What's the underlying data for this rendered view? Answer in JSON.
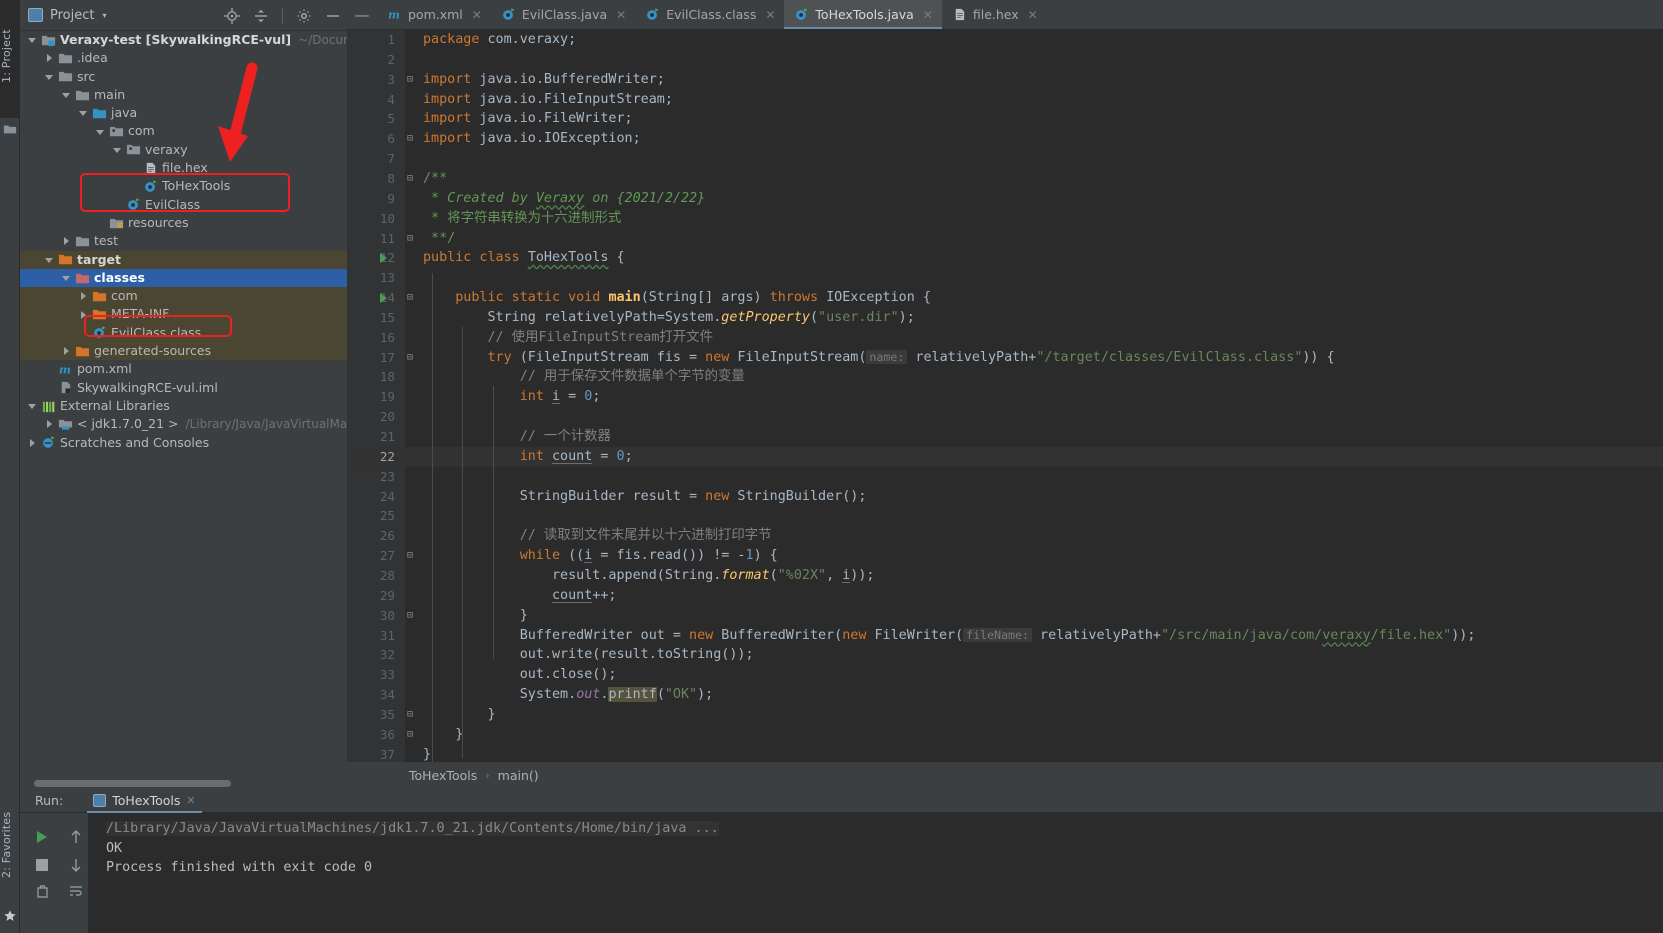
{
  "window": {
    "left_stripe": [
      {
        "label": "1: Project",
        "icon": "project-icon",
        "selected": true
      },
      {
        "label": "2: Favorites",
        "icon": "star-icon",
        "selected": false
      }
    ]
  },
  "project_panel": {
    "title": "Project",
    "caret": "▾",
    "icons": [
      "locate-icon",
      "collapse-all-icon",
      "gear-icon",
      "minimize-icon"
    ],
    "tree": [
      {
        "depth": 0,
        "arrow": "down",
        "icon": "module-icon",
        "label": "Veraxy-test [SkywalkingRCE-vul]",
        "bold": true,
        "sub": "~/Documents/"
      },
      {
        "depth": 1,
        "arrow": "right",
        "icon": "folder-icon",
        "label": ".idea"
      },
      {
        "depth": 1,
        "arrow": "down",
        "icon": "folder-icon",
        "label": "src"
      },
      {
        "depth": 2,
        "arrow": "down",
        "icon": "folder-icon",
        "label": "main"
      },
      {
        "depth": 3,
        "arrow": "down",
        "icon": "source-folder-icon",
        "label": "java"
      },
      {
        "depth": 4,
        "arrow": "down",
        "icon": "package-icon",
        "label": "com"
      },
      {
        "depth": 5,
        "arrow": "down",
        "icon": "package-icon",
        "label": "veraxy"
      },
      {
        "depth": 6,
        "arrow": "none",
        "icon": "file-icon",
        "label": "file.hex"
      },
      {
        "depth": 6,
        "arrow": "none",
        "icon": "java-class-icon",
        "label": "ToHexTools"
      },
      {
        "depth": 5,
        "arrow": "none",
        "icon": "java-class-icon",
        "label": "EvilClass"
      },
      {
        "depth": 4,
        "arrow": "none",
        "icon": "resources-folder-icon",
        "label": "resources"
      },
      {
        "depth": 2,
        "arrow": "right",
        "icon": "folder-icon",
        "label": "test"
      },
      {
        "depth": 1,
        "arrow": "down",
        "icon": "target-folder-icon",
        "label": "target",
        "bold": true,
        "context": true
      },
      {
        "depth": 2,
        "arrow": "down",
        "icon": "excluded-folder-icon",
        "label": "classes",
        "bold": true,
        "selected": true
      },
      {
        "depth": 3,
        "arrow": "right",
        "icon": "target-folder-icon",
        "label": "com",
        "context": true
      },
      {
        "depth": 3,
        "arrow": "right",
        "icon": "target-folder-icon",
        "label": "META-INF",
        "context": true
      },
      {
        "depth": 3,
        "arrow": "none",
        "icon": "java-class-icon",
        "label": "EvilClass.class",
        "context": true
      },
      {
        "depth": 2,
        "arrow": "right",
        "icon": "target-folder-icon",
        "label": "generated-sources",
        "context": true
      },
      {
        "depth": 1,
        "arrow": "none",
        "icon": "maven-icon",
        "label": "pom.xml"
      },
      {
        "depth": 1,
        "arrow": "none",
        "icon": "iml-icon",
        "label": "SkywalkingRCE-vul.iml"
      },
      {
        "depth": 0,
        "arrow": "down",
        "icon": "libraries-icon",
        "label": "External Libraries"
      },
      {
        "depth": 1,
        "arrow": "right",
        "icon": "jdk-icon",
        "label": "< jdk1.7.0_21 >",
        "sub": "/Library/Java/JavaVirtualMachin"
      },
      {
        "depth": 0,
        "arrow": "right",
        "icon": "scratches-icon",
        "label": "Scratches and Consoles"
      }
    ],
    "highlight_color": "#ef2020"
  },
  "tabs": {
    "minimize_glyph": "—",
    "items": [
      {
        "label": "pom.xml",
        "icon": "maven-icon",
        "active": false
      },
      {
        "label": "EvilClass.java",
        "icon": "java-class-icon",
        "active": false
      },
      {
        "label": "EvilClass.class",
        "icon": "java-class-icon",
        "active": false
      },
      {
        "label": "ToHexTools.java",
        "icon": "java-class-icon",
        "active": true
      },
      {
        "label": "file.hex",
        "icon": "file-icon",
        "active": false
      }
    ],
    "close_glyph": "✕"
  },
  "editor": {
    "current_line": 22,
    "lines": [
      {
        "n": 1,
        "html": "<span class=\"k\">package</span> com.veraxy;"
      },
      {
        "n": 2,
        "html": ""
      },
      {
        "n": 3,
        "fold": "⊟",
        "html": "<span class=\"k\">import</span> java.io.BufferedWriter;"
      },
      {
        "n": 4,
        "html": "<span class=\"k\">import</span> java.io.FileInputStream;"
      },
      {
        "n": 5,
        "html": "<span class=\"k\">import</span> java.io.FileWriter;"
      },
      {
        "n": 6,
        "fold": "⊟",
        "html": "<span class=\"k\">import</span> java.io.IOException;"
      },
      {
        "n": 7,
        "html": ""
      },
      {
        "n": 8,
        "fold": "⊟",
        "html": "<span class=\"jd\">/**</span>"
      },
      {
        "n": 9,
        "html": "<span class=\"jdi\"> * Created by </span><span class=\"jdi sq\">Veraxy</span><span class=\"jdi\"> on {2021/2/22}</span>"
      },
      {
        "n": 10,
        "html": "<span class=\"jd\"> * 将字符串转换为十六进制形式</span>"
      },
      {
        "n": 11,
        "fold": "⊟",
        "html": "<span class=\"jd\"> **/</span>"
      },
      {
        "n": 12,
        "run": true,
        "html": "<span class=\"k\">public class</span> <span class=\"sq\">ToHexTools</span> {"
      },
      {
        "n": 13,
        "html": ""
      },
      {
        "n": 14,
        "run": true,
        "fold": "⊟",
        "html": "    <span class=\"k\">public static void</span> <span class=\"mn\">main</span>(String[] args) <span class=\"k\">throws</span> IOException {"
      },
      {
        "n": 15,
        "html": "        String relativelyPath=System.<span class=\"f\" style=\"font-style:italic\">getProperty</span>(<span class=\"s\">\"user.dir\"</span>);"
      },
      {
        "n": 16,
        "html": "        <span class=\"c\">// 使用FileInputStream打开文件</span>"
      },
      {
        "n": 17,
        "fold": "⊟",
        "html": "        <span class=\"k\">try</span> (FileInputStream fis = <span class=\"k\">new</span> FileInputStream(<span class=\"hint\">name:</span> relativelyPath+<span class=\"s\">\"/target/classes/EvilClass.class\"</span>)) {"
      },
      {
        "n": 18,
        "html": "            <span class=\"c\">// 用于保存文件数据单个字节的变量</span>"
      },
      {
        "n": 19,
        "html": "            <span class=\"k\">int</span> <span class=\"ul\">i</span> = <span class=\"n\">0</span>;"
      },
      {
        "n": 20,
        "html": ""
      },
      {
        "n": 21,
        "html": "            <span class=\"c\">// 一个计数器</span>"
      },
      {
        "n": 22,
        "html": "            <span class=\"k\">int</span> <span class=\"ul\">count</span> = <span class=\"n\">0</span>;"
      },
      {
        "n": 23,
        "html": ""
      },
      {
        "n": 24,
        "html": "            StringBuilder result = <span class=\"k\">new</span> StringBuilder();"
      },
      {
        "n": 25,
        "html": ""
      },
      {
        "n": 26,
        "html": "            <span class=\"c\">// 读取到文件末尾并以十六进制打印字节</span>"
      },
      {
        "n": 27,
        "fold": "⊟",
        "html": "            <span class=\"k\">while</span> ((<span class=\"ul\">i</span> = fis.read()) != -<span class=\"n\">1</span>) {"
      },
      {
        "n": 28,
        "html": "                result.append(String.<span class=\"f\" style=\"font-style:italic\">format</span>(<span class=\"s\">\"%02X\"</span>, <span class=\"ul\">i</span>));"
      },
      {
        "n": 29,
        "html": "                <span class=\"ul\">count</span>++;"
      },
      {
        "n": 30,
        "fold": "⊟",
        "html": "            }"
      },
      {
        "n": 31,
        "html": "            BufferedWriter out = <span class=\"k\">new</span> BufferedWriter(<span class=\"k\">new</span> FileWriter(<span class=\"hint\">fileName:</span> relativelyPath+<span class=\"s\">\"/src/main/java/com/<span class=\"sq\">veraxy</span>/file.hex\"</span>));"
      },
      {
        "n": 32,
        "html": "            out.write(result.toString());"
      },
      {
        "n": 33,
        "html": "            out.close();"
      },
      {
        "n": 34,
        "html": "            System.<span class=\"st\" style=\"font-style:italic\">out</span>.<span class=\"hl\">printf</span>(<span class=\"s\">\"OK\"</span>);"
      },
      {
        "n": 35,
        "fold": "⊟",
        "html": "        }"
      },
      {
        "n": 36,
        "fold": "⊟",
        "html": "    }"
      },
      {
        "n": 37,
        "html": "}"
      }
    ],
    "breadcrumb": [
      "ToHexTools",
      "main()"
    ],
    "breadcrumb_sep": "›"
  },
  "run_panel": {
    "label": "Run:",
    "tab": "ToHexTools",
    "tab_icon": "run-config-icon",
    "close_glyph": "✕",
    "toolbar": [
      "run-icon",
      "up-icon",
      "stop-icon",
      "down-icon",
      "trash-icon",
      "wrap-icon"
    ],
    "console": [
      {
        "text": "/Library/Java/JavaVirtualMachines/jdk1.7.0_21.jdk/Contents/Home/bin/java ...",
        "dim": true
      },
      {
        "text": "OK",
        "dim": false
      },
      {
        "text": "Process finished with exit code 0",
        "dim": false
      }
    ]
  },
  "colors": {
    "bg": "#3c3f41",
    "editor_bg": "#2b2b2b",
    "accent": "#2d5fa6",
    "highlight": "#ef2020",
    "gutter": "#313335",
    "context": "#4b4631"
  }
}
